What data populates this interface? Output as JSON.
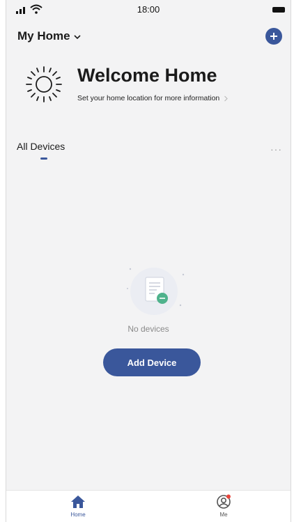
{
  "status_bar": {
    "time": "18:00"
  },
  "header": {
    "home_name": "My Home"
  },
  "welcome": {
    "title": "Welcome Home",
    "subtitle": "Set your home location for more information"
  },
  "devices": {
    "tab_label": "All Devices",
    "more_label": "···",
    "empty_text": "No devices",
    "add_button_label": "Add Device"
  },
  "bottom_nav": {
    "items": [
      {
        "label": "Home",
        "icon": "home-icon",
        "active": true
      },
      {
        "label": "Me",
        "icon": "profile-icon",
        "active": false,
        "has_badge": true
      }
    ]
  },
  "colors": {
    "accent": "#3a579b",
    "background": "#f3f3f4",
    "badge": "#e8453c",
    "illustration_green": "#4fb28c"
  }
}
